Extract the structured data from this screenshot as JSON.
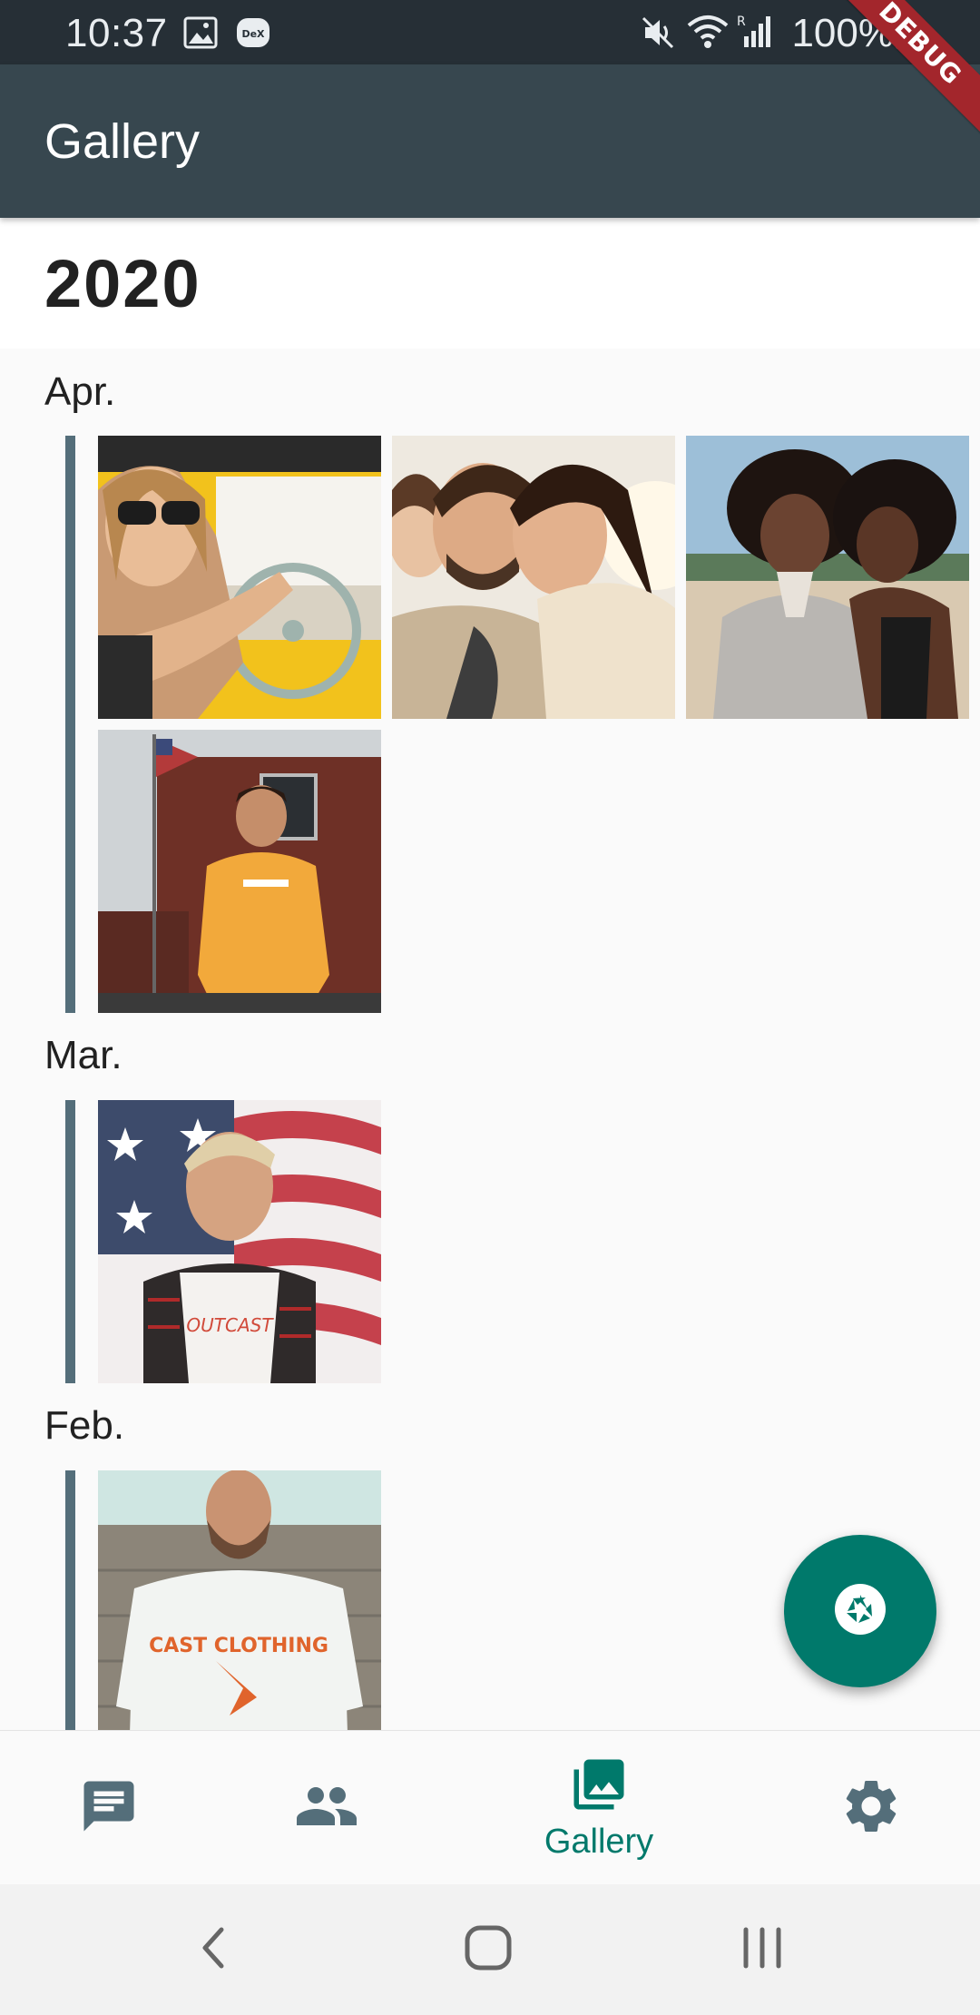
{
  "status_bar": {
    "time": "10:37",
    "battery": "100%",
    "left_icons": [
      "image-icon",
      "dex-icon"
    ],
    "right_icons": [
      "mute-icon",
      "wifi-icon",
      "signal-icon",
      "battery-icon"
    ]
  },
  "debug_banner": "DEBUG",
  "app_bar": {
    "title": "Gallery",
    "background": "#37474f"
  },
  "gallery": {
    "year": "2020",
    "months": [
      {
        "label": "Apr.",
        "photos": [
          "photo-woman-driving",
          "photo-family-selfie",
          "photo-two-friends-beach",
          "photo-man-orange-sweater"
        ]
      },
      {
        "label": "Mar.",
        "photos": [
          "photo-man-flag-mural"
        ]
      },
      {
        "label": "Feb.",
        "photos": [
          "photo-man-white-tshirt"
        ]
      }
    ]
  },
  "fab": {
    "icon": "camera-shutter-icon",
    "color": "#00796b"
  },
  "bottom_nav": {
    "items": [
      {
        "icon": "chat-icon",
        "label": "",
        "active": false
      },
      {
        "icon": "people-icon",
        "label": "",
        "active": false
      },
      {
        "icon": "photo-library-icon",
        "label": "Gallery",
        "active": true
      },
      {
        "icon": "settings-icon",
        "label": "",
        "active": false
      }
    ],
    "active_color": "#00796b",
    "inactive_color": "#546e7a"
  },
  "system_nav": {
    "icons": [
      "back-icon",
      "home-icon",
      "recents-icon"
    ]
  }
}
